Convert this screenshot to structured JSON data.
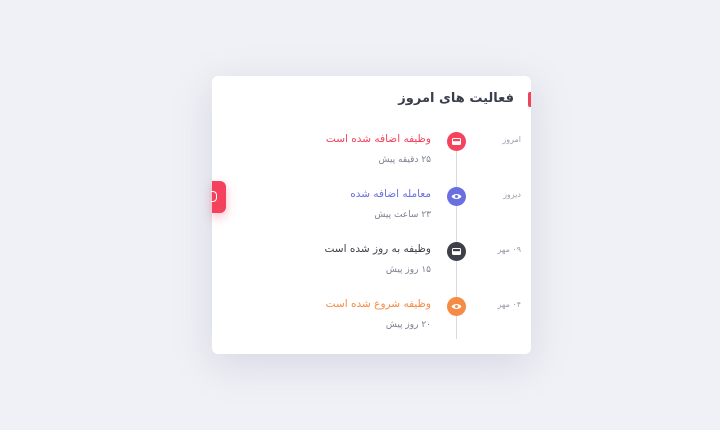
{
  "card": {
    "title": "فعالیت های امروز",
    "accent_color": "#f0435a"
  },
  "timeline": [
    {
      "date": "امروز",
      "title": "وظیفه اضافه شده است",
      "subtitle": "۲۵ دقیقه پیش",
      "color": "#f4435d",
      "icon": "inbox-icon"
    },
    {
      "date": "دیروز",
      "title": "معامله اضافه شده",
      "subtitle": "۲۳ ساعت پیش",
      "color": "#6a6fe0",
      "icon": "eye-icon"
    },
    {
      "date": "۰۹ مهر",
      "title": "وظیفه به روز شده است",
      "subtitle": "۱۵ روز پیش",
      "color": "#3d3f49",
      "icon": "inbox-icon"
    },
    {
      "date": "۰۴ مهر",
      "title": "وظیفه شروع شده است",
      "subtitle": "۲۰ روز پیش",
      "color": "#f58b45",
      "icon": "eye-icon"
    }
  ]
}
